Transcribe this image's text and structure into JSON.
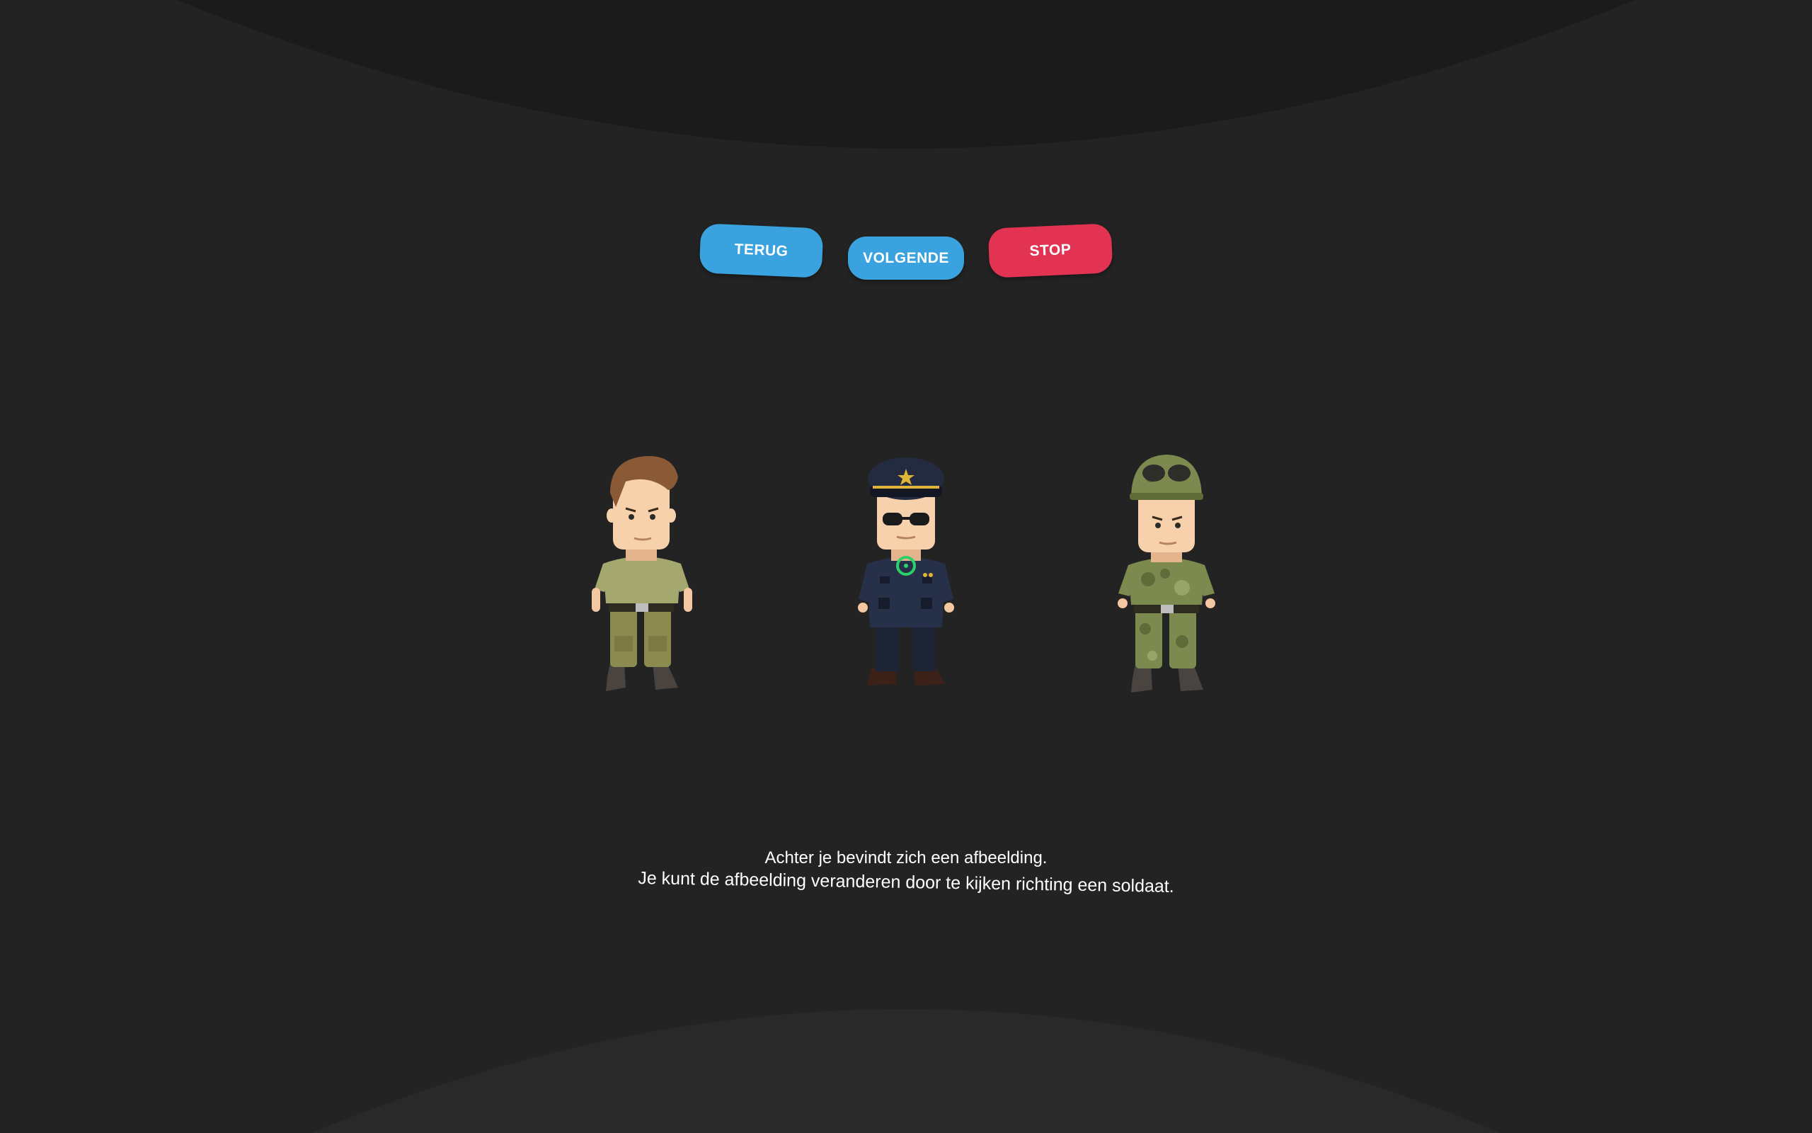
{
  "buttons": {
    "back_label": "TERUG",
    "next_label": "VOLGENDE",
    "stop_label": "STOP"
  },
  "characters": [
    {
      "icon": "casual-soldier-icon"
    },
    {
      "icon": "police-officer-icon"
    },
    {
      "icon": "camo-soldier-icon"
    }
  ],
  "caption": {
    "line1": "Achter je bevindt zich een afbeelding.",
    "line2": "Je kunt de afbeelding veranderen door te kijken richting een soldaat."
  },
  "colors": {
    "background": "#232323",
    "button_blue": "#3aa3df",
    "button_red": "#e23352",
    "gaze_cursor": "#2fd06b"
  }
}
